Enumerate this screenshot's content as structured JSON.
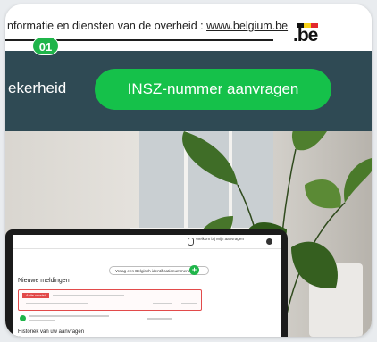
{
  "govbar": {
    "text": "nformatie en diensten van de overheid : ",
    "link": "www.belgium.be",
    "logo_text": ".be"
  },
  "badge": {
    "label": "01"
  },
  "navbar": {
    "left_label": "ekerheid",
    "cta_label": "INSZ-nummer aanvragen"
  },
  "laptop_screen": {
    "user_label": "Welkom bij Mijn aanvragen",
    "link_button": "Vraag een Belgisch identificatienummer aan",
    "section1_title": "Nieuwe meldingen",
    "alert_tag": "Actie vereist",
    "section2_title": "Historiek van uw aanvragen"
  },
  "colors": {
    "accent_green": "#15c14a",
    "navbar_teal": "#2f4a54",
    "badge_green": "#1fb54a",
    "alert_red": "#e24b4b"
  },
  "icons": [
    "belgium-flag-icon",
    "plus-icon",
    "user-icon",
    "settings-icon",
    "check-icon"
  ]
}
